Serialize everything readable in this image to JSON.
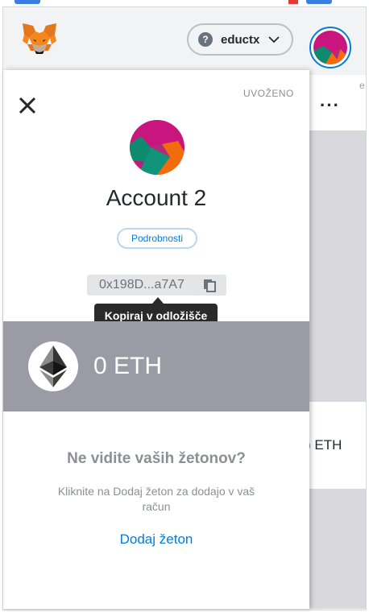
{
  "header": {
    "network_label": "eductx",
    "network_icon": "question-mark-circle-icon"
  },
  "account": {
    "imported_badge": "UVOŽENO",
    "name": "Account 2",
    "details_button": "Podrobnosti",
    "address_short": "0x198D...a7A7",
    "copy_tooltip": "Kopiraj v odložišče",
    "balance": "0 ETH"
  },
  "tokens": {
    "empty_title": "Ne vidite vaših žetonov?",
    "empty_help": "Kliknite na Dodaj žeton za dodajo v vaš račun",
    "add_token_link": "Dodaj žeton"
  },
  "background": {
    "balance_fragment": ") ETH"
  },
  "colors": {
    "accent_blue": "#037dd6",
    "balance_band": "#9a9ba5",
    "tooltip_bg": "#2a2a2a",
    "header_bg": "#f2f3f4"
  }
}
